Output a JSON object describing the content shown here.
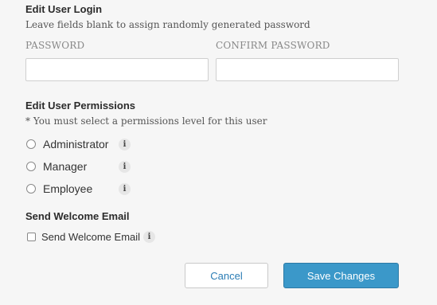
{
  "login": {
    "title": "Edit User Login",
    "help": "Leave fields blank to assign randomly generated password",
    "password_label": "PASSWORD",
    "password_value": "",
    "confirm_label": "CONFIRM PASSWORD",
    "confirm_value": ""
  },
  "permissions": {
    "title": "Edit User Permissions",
    "help": "* You must select a permissions level for this user",
    "options": [
      {
        "label": "Administrator",
        "selected": false,
        "info_icon": "i"
      },
      {
        "label": "Manager",
        "selected": false,
        "info_icon": "i"
      },
      {
        "label": "Employee",
        "selected": false,
        "info_icon": "i"
      }
    ]
  },
  "welcome": {
    "title": "Send Welcome Email",
    "checkbox_label": "Send Welcome Email",
    "checked": false,
    "info_icon": "i"
  },
  "actions": {
    "cancel_label": "Cancel",
    "save_label": "Save Changes"
  },
  "colors": {
    "accent": "#3b98c9",
    "link": "#2b7db5",
    "background": "#f6f6f6"
  }
}
